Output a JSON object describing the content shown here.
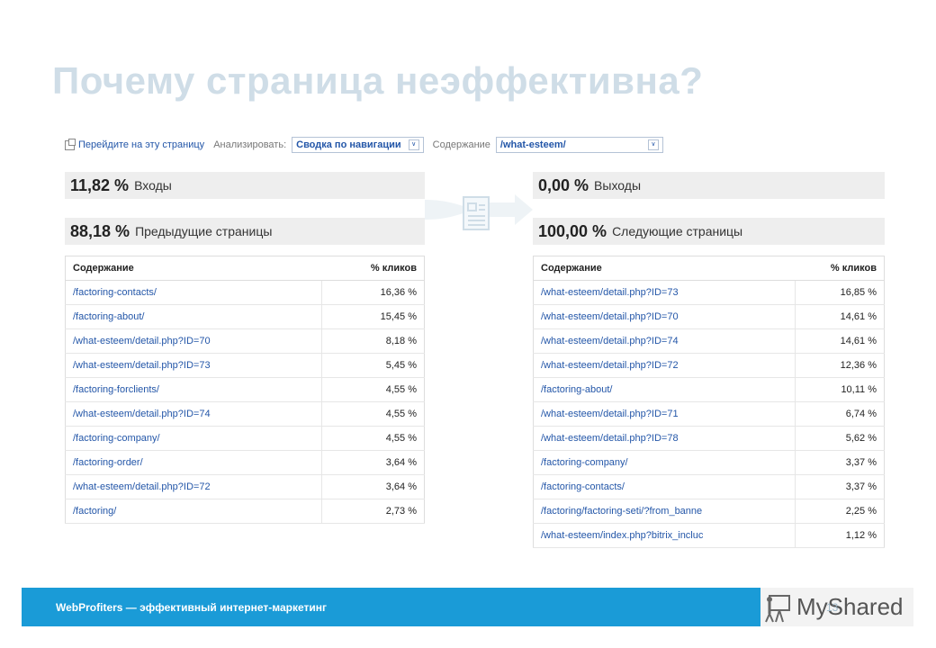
{
  "title": "Почему страница неэффективна?",
  "toolbar": {
    "goto_link": "Перейдите на эту страницу",
    "analyze_label": "Анализировать:",
    "analyze_value": "Сводка по навигации",
    "content_label": "Содержание",
    "content_value": "/what-esteem/"
  },
  "entrances": {
    "value": "11,82 %",
    "label": "Входы"
  },
  "exits": {
    "value": "0,00 %",
    "label": "Выходы"
  },
  "previous_pages": {
    "value": "88,18 %",
    "label": "Предыдущие страницы"
  },
  "next_pages": {
    "value": "100,00 %",
    "label": "Следующие страницы"
  },
  "left_table": {
    "col_content": "Содержание",
    "col_pct": "% кликов",
    "rows": [
      {
        "page": "/factoring-contacts/",
        "pct": "16,36 %"
      },
      {
        "page": "/factoring-about/",
        "pct": "15,45 %"
      },
      {
        "page": "/what-esteem/detail.php?ID=70",
        "pct": "8,18 %"
      },
      {
        "page": "/what-esteem/detail.php?ID=73",
        "pct": "5,45 %"
      },
      {
        "page": "/factoring-forclients/",
        "pct": "4,55 %"
      },
      {
        "page": "/what-esteem/detail.php?ID=74",
        "pct": "4,55 %"
      },
      {
        "page": "/factoring-company/",
        "pct": "4,55 %"
      },
      {
        "page": "/factoring-order/",
        "pct": "3,64 %"
      },
      {
        "page": "/what-esteem/detail.php?ID=72",
        "pct": "3,64 %"
      },
      {
        "page": "/factoring/",
        "pct": "2,73 %"
      }
    ]
  },
  "right_table": {
    "col_content": "Содержание",
    "col_pct": "% кликов",
    "rows": [
      {
        "page": "/what-esteem/detail.php?ID=73",
        "pct": "16,85 %"
      },
      {
        "page": "/what-esteem/detail.php?ID=70",
        "pct": "14,61 %"
      },
      {
        "page": "/what-esteem/detail.php?ID=74",
        "pct": "14,61 %"
      },
      {
        "page": "/what-esteem/detail.php?ID=72",
        "pct": "12,36 %"
      },
      {
        "page": "/factoring-about/",
        "pct": "10,11 %"
      },
      {
        "page": "/what-esteem/detail.php?ID=71",
        "pct": "6,74 %"
      },
      {
        "page": "/what-esteem/detail.php?ID=78",
        "pct": "5,62 %"
      },
      {
        "page": "/factoring-company/",
        "pct": "3,37 %"
      },
      {
        "page": "/factoring-contacts/",
        "pct": "3,37 %"
      },
      {
        "page": "/factoring/factoring-seti/?from_banne",
        "pct": "2,25 %"
      },
      {
        "page": "/what-esteem/index.php?bitrix_incluc",
        "pct": "1,12 %"
      }
    ]
  },
  "footer": {
    "text": "WebProfiters — эффективный интернет-маркетинг",
    "page_number": "13"
  },
  "logo": {
    "text": "MyShared"
  },
  "icons": {
    "flow": "arrow-right-icon",
    "page": "document-icon",
    "external": "external-link-icon",
    "dropdown": "chevron-down-icon",
    "logo": "presenter-icon"
  },
  "colors": {
    "title": "#cfdde7",
    "link": "#2356a8",
    "footer": "#1a9bd7",
    "metric_bg": "#eeeeee"
  }
}
